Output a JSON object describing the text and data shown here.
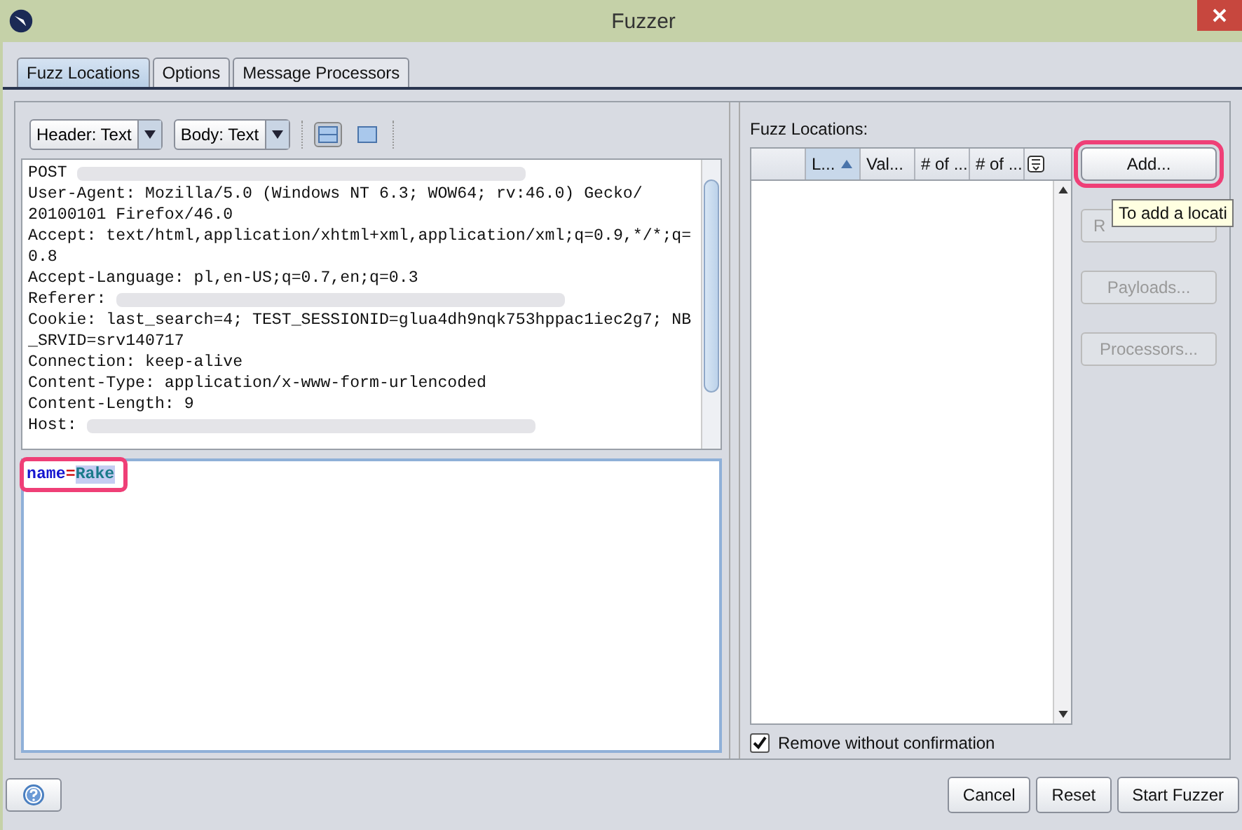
{
  "window": {
    "title": "Fuzzer"
  },
  "tabs": [
    {
      "label": "Fuzz Locations",
      "selected": true
    },
    {
      "label": "Options",
      "selected": false
    },
    {
      "label": "Message Processors",
      "selected": false
    }
  ],
  "toolbar": {
    "dropdowns": [
      "Header: Text",
      "Body: Text"
    ],
    "views": [
      {
        "selected": true
      },
      {
        "selected": false
      }
    ]
  },
  "request_header": [
    {
      "text": "POST ",
      "redacted": true
    },
    {
      "text": "User-Agent: Mozilla/5.0 (Windows NT 6.3; WOW64; rv:46.0) Gecko/",
      "redacted": false
    },
    {
      "text": "20100101 Firefox/46.0",
      "redacted": false
    },
    {
      "text": "Accept: text/html,application/xhtml+xml,application/xml;q=0.9,*/*;q=",
      "redacted": false
    },
    {
      "text": "0.8",
      "redacted": false
    },
    {
      "text": "Accept-Language: pl,en-US;q=0.7,en;q=0.3",
      "redacted": false
    },
    {
      "text": "Referer: ",
      "redacted": true
    },
    {
      "text": "Cookie: last_search=4; TEST_SESSIONID=glua4dh9nqk753hppac1iec2g7; NB",
      "redacted": false
    },
    {
      "text": "_SRVID=srv140717",
      "redacted": false
    },
    {
      "text": "Connection: keep-alive",
      "redacted": false
    },
    {
      "text": "Content-Type: application/x-www-form-urlencoded",
      "redacted": false
    },
    {
      "text": "Content-Length: 9",
      "redacted": false
    },
    {
      "text": "Host: ",
      "redacted": true
    }
  ],
  "request_body": {
    "param": "name",
    "sep": "=",
    "value": "Rake",
    "value_selected": true
  },
  "fuzz_locations": {
    "label": "Fuzz Locations:",
    "columns": [
      {
        "sorted": false
      },
      {
        "label": "L...",
        "sorted": true
      },
      {
        "label": "Val...",
        "sorted": false
      },
      {
        "label": "# of ...",
        "sorted": false
      },
      {
        "label": "# of ...",
        "sorted": false
      }
    ],
    "buttons": [
      {
        "label": "Add...",
        "disabled": false
      },
      {
        "label": "R",
        "disabled": true
      },
      {
        "label": "Payloads...",
        "disabled": true
      },
      {
        "label": "Processors...",
        "disabled": true
      }
    ],
    "tooltip": "To add a locati",
    "remove_without_confirmation": {
      "label": "Remove without confirmation",
      "checked": true
    }
  },
  "footer_buttons": [
    "Cancel",
    "Reset",
    "Start Fuzzer"
  ]
}
